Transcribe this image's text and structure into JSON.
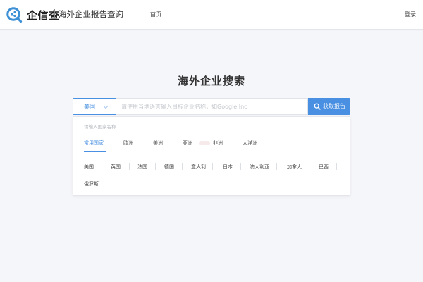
{
  "header": {
    "brand": "企信查",
    "subtitle": "海外企业报告查询",
    "nav_home": "首页",
    "nav_login": "登录"
  },
  "main": {
    "title": "海外企业搜索",
    "search": {
      "selected_country": "美国",
      "placeholder": "请使用当地语言输入目标企业名称，如Google Inc",
      "button_label": "获取报告"
    },
    "dropdown": {
      "filter_placeholder": "请输入国家名称",
      "regions": [
        {
          "label": "常用国家",
          "active": true
        },
        {
          "label": "欧洲",
          "active": false
        },
        {
          "label": "美洲",
          "active": false
        },
        {
          "label": "亚洲",
          "active": false
        },
        {
          "label": "非洲",
          "active": false
        },
        {
          "label": "大洋洲",
          "active": false
        }
      ],
      "countries": [
        "美国",
        "英国",
        "法国",
        "德国",
        "意大利",
        "日本",
        "澳大利亚",
        "加拿大",
        "巴西",
        "俄罗斯"
      ]
    }
  },
  "colors": {
    "accent": "#4a90e2",
    "background": "#f5f6fa",
    "logo": "#3d8fd6"
  }
}
